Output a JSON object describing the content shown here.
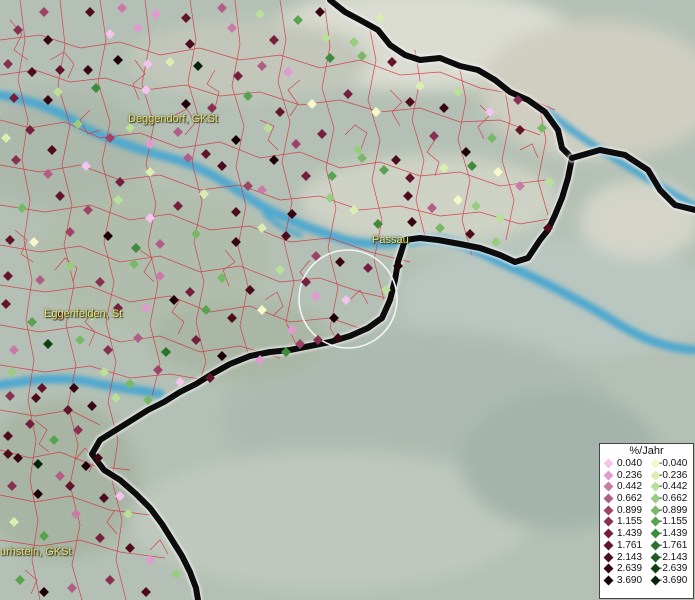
{
  "map": {
    "places": [
      {
        "id": "deggendorf",
        "label": "Deggendorf, GKSt"
      },
      {
        "id": "passau",
        "label": "Passau"
      },
      {
        "id": "eggenfelden",
        "label": "Eggenfelden, St"
      },
      {
        "id": "burghausen",
        "label": "urhstein, GKSt"
      }
    ]
  },
  "legend": {
    "title": "%/Jahr",
    "positive": [
      {
        "label": "0.040",
        "color": "#f2c4ee"
      },
      {
        "label": "0.236",
        "color": "#e19ad0"
      },
      {
        "label": "0.442",
        "color": "#c97aa7"
      },
      {
        "label": "0.662",
        "color": "#b25d88"
      },
      {
        "label": "0.899",
        "color": "#9c4468"
      },
      {
        "label": "1.155",
        "color": "#873052"
      },
      {
        "label": "1.439",
        "color": "#741f3e"
      },
      {
        "label": "1.761",
        "color": "#61142c"
      },
      {
        "label": "2.143",
        "color": "#4d0c1d"
      },
      {
        "label": "2.639",
        "color": "#360612"
      },
      {
        "label": "3.690",
        "color": "#1c0208"
      }
    ],
    "negative": [
      {
        "label": "-0.040",
        "color": "#f7f8c8"
      },
      {
        "label": "-0.236",
        "color": "#d9eeb0"
      },
      {
        "label": "-0.442",
        "color": "#b9df98"
      },
      {
        "label": "-0.662",
        "color": "#98cd80"
      },
      {
        "label": "-0.899",
        "color": "#77b967"
      },
      {
        "label": "-1.155",
        "color": "#58a34f"
      },
      {
        "label": "-1.439",
        "color": "#3f8a3c"
      },
      {
        "label": "-1.761",
        "color": "#2b722d"
      },
      {
        "label": "-2.143",
        "color": "#1c5a20"
      },
      {
        "label": "-2.639",
        "color": "#0f4014"
      },
      {
        "label": "-3.690",
        "color": "#05240a"
      }
    ]
  }
}
